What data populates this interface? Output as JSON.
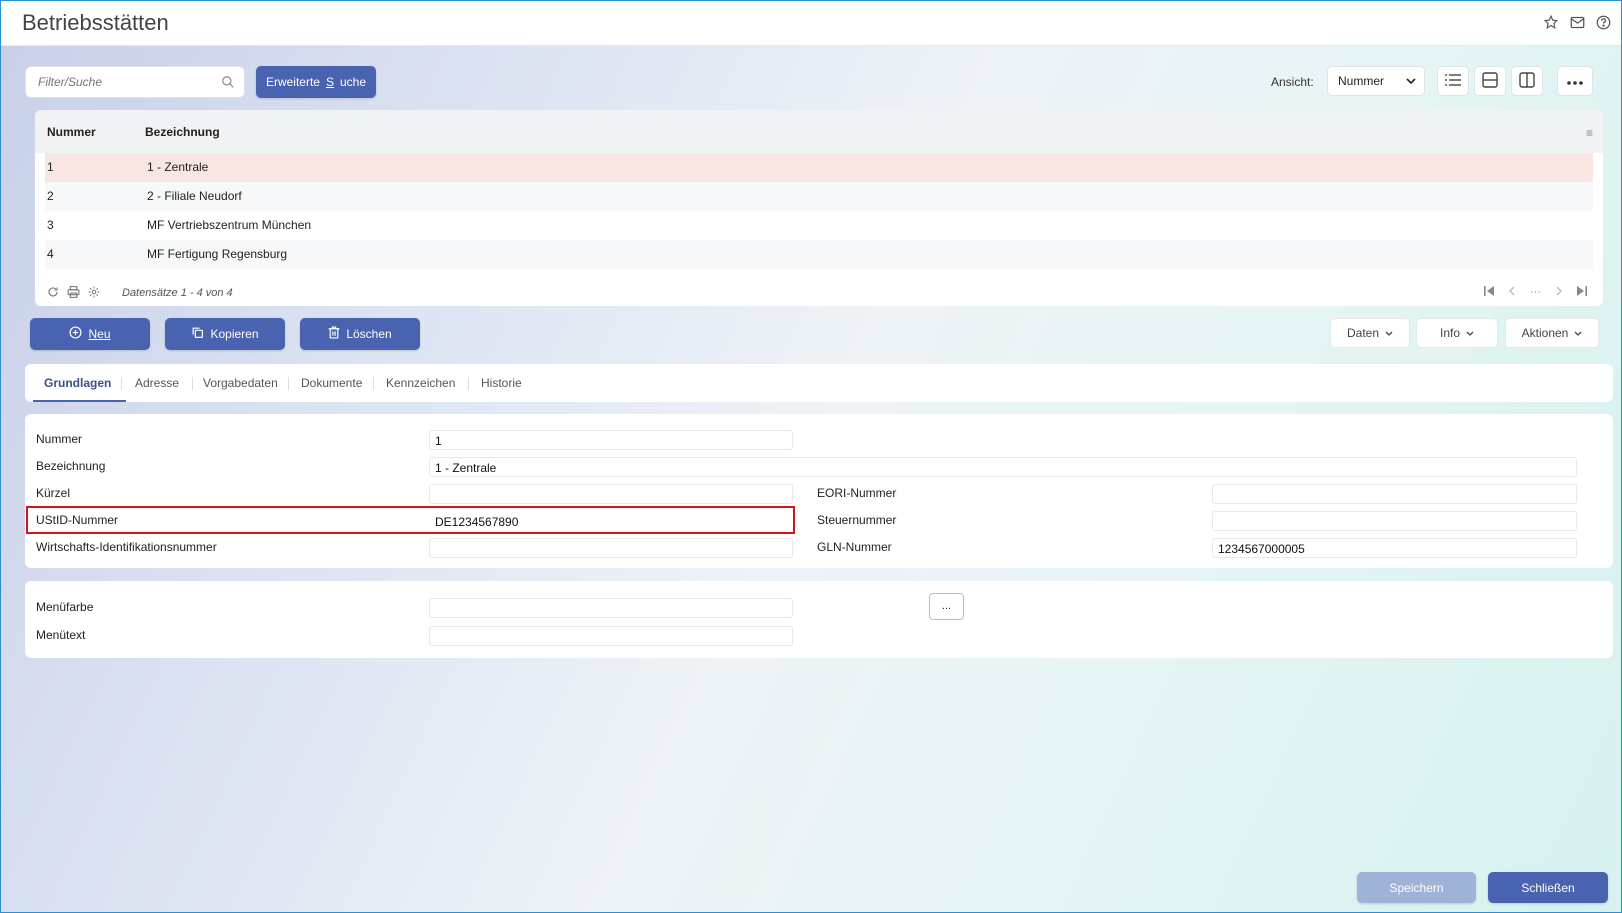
{
  "header": {
    "title": "Betriebsstätten",
    "icons": [
      "star-icon",
      "mail-icon",
      "help-icon"
    ]
  },
  "toolbar": {
    "search_placeholder": "Filter/Suche",
    "advanced_search_label": "Erweiterte Suche",
    "view_label": "Ansicht:",
    "view_value": "Nummer"
  },
  "table": {
    "columns": [
      "Nummer",
      "Bezeichnung"
    ],
    "rows": [
      {
        "nummer": "1",
        "bezeichnung": "1 - Zentrale",
        "selected": true
      },
      {
        "nummer": "2",
        "bezeichnung": "2 - Filiale Neudorf"
      },
      {
        "nummer": "3",
        "bezeichnung": "MF Vertriebszentrum München"
      },
      {
        "nummer": "4",
        "bezeichnung": "MF Fertigung Regensburg"
      }
    ],
    "record_count": "Datensätze 1 - 4 von 4"
  },
  "actions": {
    "new": "Neu",
    "copy": "Kopieren",
    "delete": "Löschen",
    "data": "Daten",
    "info": "Info",
    "actions": "Aktionen"
  },
  "tabs": [
    "Grundlagen",
    "Adresse",
    "Vorgabedaten",
    "Dokumente",
    "Kennzeichen",
    "Historie"
  ],
  "form": {
    "nummer_label": "Nummer",
    "nummer_value": "1",
    "bezeichnung_label": "Bezeichnung",
    "bezeichnung_value": "1 - Zentrale",
    "kuerzel_label": "Kürzel",
    "kuerzel_value": "",
    "ustid_label": "UStID-Nummer",
    "ustid_value": "DE1234567890",
    "wirtschaft_label": "Wirtschafts-Identifikationsnummer",
    "wirtschaft_value": "",
    "eori_label": "EORI-Nummer",
    "eori_value": "",
    "steuer_label": "Steuernummer",
    "steuer_value": "",
    "gln_label": "GLN-Nummer",
    "gln_value": "1234567000005"
  },
  "menu_form": {
    "farbe_label": "Menüfarbe",
    "farbe_value": "",
    "text_label": "Menütext",
    "text_value": "",
    "dots_label": "..."
  },
  "footer": {
    "save": "Speichern",
    "close": "Schließen"
  },
  "colors": {
    "primary": "#4a63b0",
    "highlight": "#d7141a",
    "selected_row": "#f8e6e2"
  }
}
